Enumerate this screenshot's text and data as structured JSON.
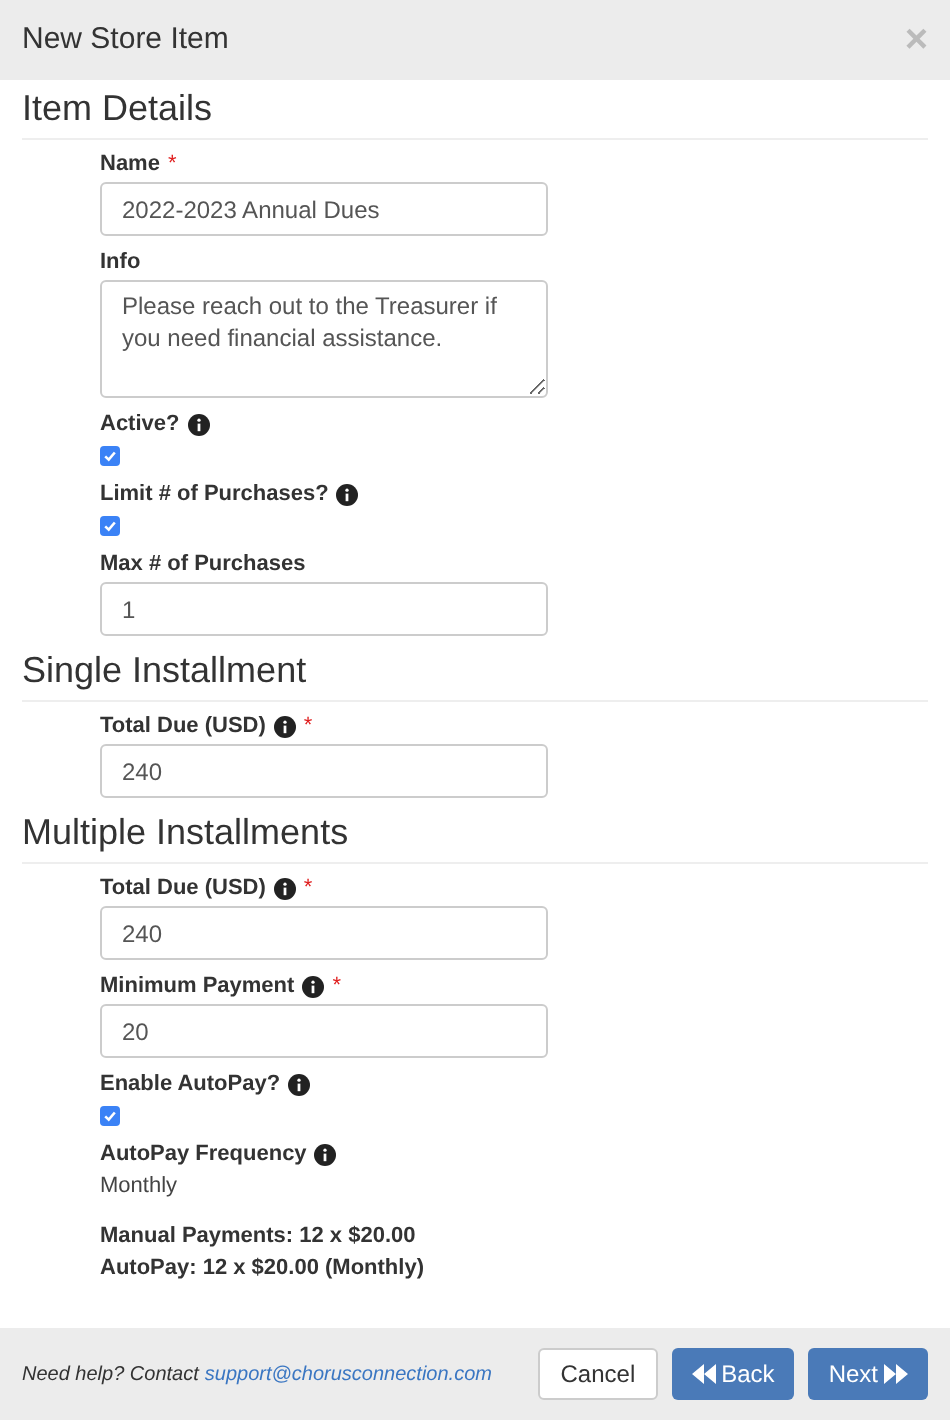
{
  "dialog": {
    "title": "New Store Item",
    "close": "×"
  },
  "sections": [
    {
      "heading": "Item Details",
      "fields": [
        {
          "kind": "input",
          "label": "Name",
          "required_mark": "*",
          "info": false,
          "value": "2022-2023 Annual Dues"
        },
        {
          "kind": "textarea",
          "label": "Info",
          "info": false,
          "value": "Please reach out to the Treasurer if you need financial assistance."
        },
        {
          "kind": "checkbox",
          "label": "Active?",
          "info": true,
          "checked": true
        },
        {
          "kind": "checkbox",
          "label": "Limit # of Purchases?",
          "info": true,
          "checked": true
        },
        {
          "kind": "input",
          "label": "Max # of Purchases",
          "info": false,
          "value": "1"
        }
      ]
    },
    {
      "heading": "Single Installment",
      "fields": [
        {
          "kind": "input",
          "label": "Total Due (USD)",
          "required_mark": "*",
          "info": true,
          "value": "240"
        }
      ]
    },
    {
      "heading": "Multiple Installments",
      "fields": [
        {
          "kind": "input",
          "label": "Total Due (USD)",
          "required_mark": "*",
          "info": true,
          "value": "240"
        },
        {
          "kind": "input",
          "label": "Minimum Payment",
          "required_mark": "*",
          "info": true,
          "value": "20"
        },
        {
          "kind": "checkbox",
          "label": "Enable AutoPay?",
          "info": true,
          "checked": true
        },
        {
          "kind": "static",
          "label": "AutoPay Frequency",
          "info": true,
          "value": "Monthly"
        },
        {
          "kind": "summary",
          "lines": [
            "Manual Payments: 12 x $20.00",
            "AutoPay: 12 x $20.00 (Monthly)"
          ]
        }
      ]
    }
  ],
  "footer": {
    "help": "Need help? Contact",
    "email": "support@chorusconnection.com",
    "buttons": [
      {
        "kind": "plain",
        "label": "Cancel"
      },
      {
        "kind": "back",
        "label": "Back"
      },
      {
        "kind": "next",
        "label": "Next"
      }
    ]
  }
}
